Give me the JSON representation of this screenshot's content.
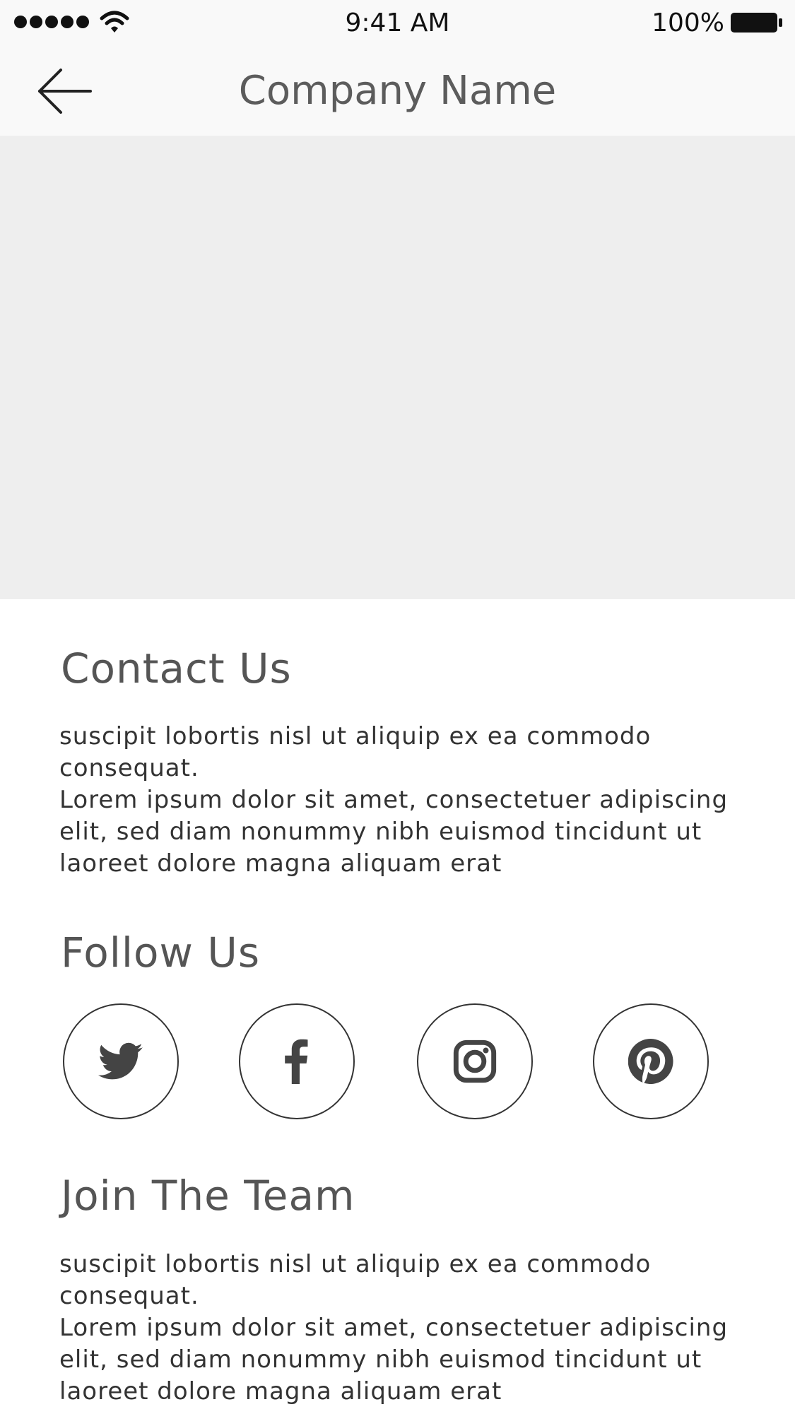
{
  "status_bar": {
    "time": "9:41 AM",
    "battery_percent": "100%",
    "signal_bars": 5
  },
  "nav": {
    "title": "Company Name"
  },
  "contact": {
    "heading": "Contact Us",
    "line1": "suscipit lobortis nisl ut aliquip ex ea commodo consequat.",
    "line2": "Lorem ipsum dolor sit amet, consectetuer adipiscing elit, sed diam nonummy nibh euismod tincidunt ut laoreet dolore magna aliquam erat"
  },
  "follow": {
    "heading": "Follow Us",
    "networks": [
      {
        "icon": "twitter-icon"
      },
      {
        "icon": "facebook-icon"
      },
      {
        "icon": "instagram-icon"
      },
      {
        "icon": "pinterest-icon"
      }
    ]
  },
  "join": {
    "heading": "Join The Team",
    "line1": "suscipit lobortis nisl ut aliquip ex ea commodo consequat.",
    "line2": "Lorem ipsum dolor sit amet, consectetuer adipiscing elit, sed diam nonummy nibh euismod tincidunt ut laoreet dolore magna aliquam erat"
  },
  "colors": {
    "bar_background": "#f9f9f9",
    "hero_placeholder": "#eeeeee",
    "heading_text": "#555555",
    "body_text": "#333333"
  }
}
